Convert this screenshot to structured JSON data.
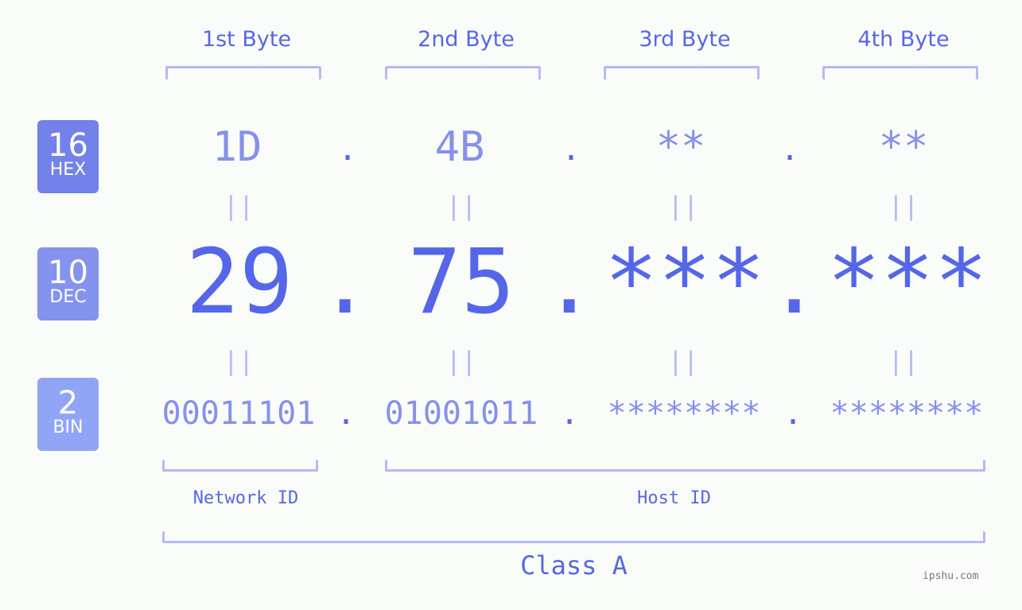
{
  "bytes": [
    {
      "label": "1st Byte",
      "hex": "1D",
      "dec": "29",
      "bin": "00011101"
    },
    {
      "label": "2nd Byte",
      "hex": "4B",
      "dec": "75",
      "bin": "01001011"
    },
    {
      "label": "3rd Byte",
      "hex": "**",
      "dec": "***",
      "bin": "********"
    },
    {
      "label": "4th Byte",
      "hex": "**",
      "dec": "***",
      "bin": "********"
    }
  ],
  "bases": {
    "hex": {
      "num": "16",
      "label": "HEX",
      "color": "#7282ea"
    },
    "dec": {
      "num": "10",
      "label": "DEC",
      "color": "#8493ee"
    },
    "bin": {
      "num": "2",
      "label": "BIN",
      "color": "#90a5f6"
    }
  },
  "separator": ".",
  "equals": "||",
  "segments": {
    "network": "Network ID",
    "host": "Host ID"
  },
  "class_label": "Class A",
  "watermark": "ipshu.com"
}
